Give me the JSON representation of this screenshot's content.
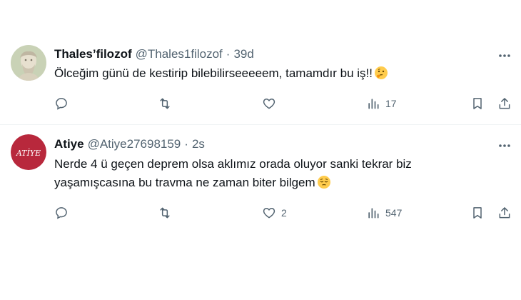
{
  "tweets": [
    {
      "name": "Thales’filozof",
      "handle": "@Thales1filozof",
      "separator": "·",
      "time": "39d",
      "text": "Ölceğim günü de kestirip bilebilirseeeeem, tamamdır bu iş!!",
      "emoji": "thinking-face-emoji",
      "avatar": "philosopher-statue-avatar",
      "reply_count": "",
      "retweet_count": "",
      "like_count": "",
      "view_count": "17"
    },
    {
      "name": "Atiye",
      "handle": "@Atiye27698159",
      "separator": "·",
      "time": "2s",
      "text": "Nerde 4 ü geçen deprem olsa aklımız orada oluyor sanki tekrar biz yaşamışcasına bu travma ne zaman biter bilgem",
      "emoji": "pensive-face-emoji",
      "avatar_text": "ATİYE",
      "avatar_color": "#b8283c",
      "reply_count": "",
      "retweet_count": "",
      "like_count": "2",
      "view_count": "547"
    }
  ],
  "icons": {
    "more": "more-dots-icon",
    "reply": "reply-icon",
    "retweet": "retweet-icon",
    "like": "like-icon",
    "views": "views-icon",
    "bookmark": "bookmark-icon",
    "share": "share-icon"
  }
}
